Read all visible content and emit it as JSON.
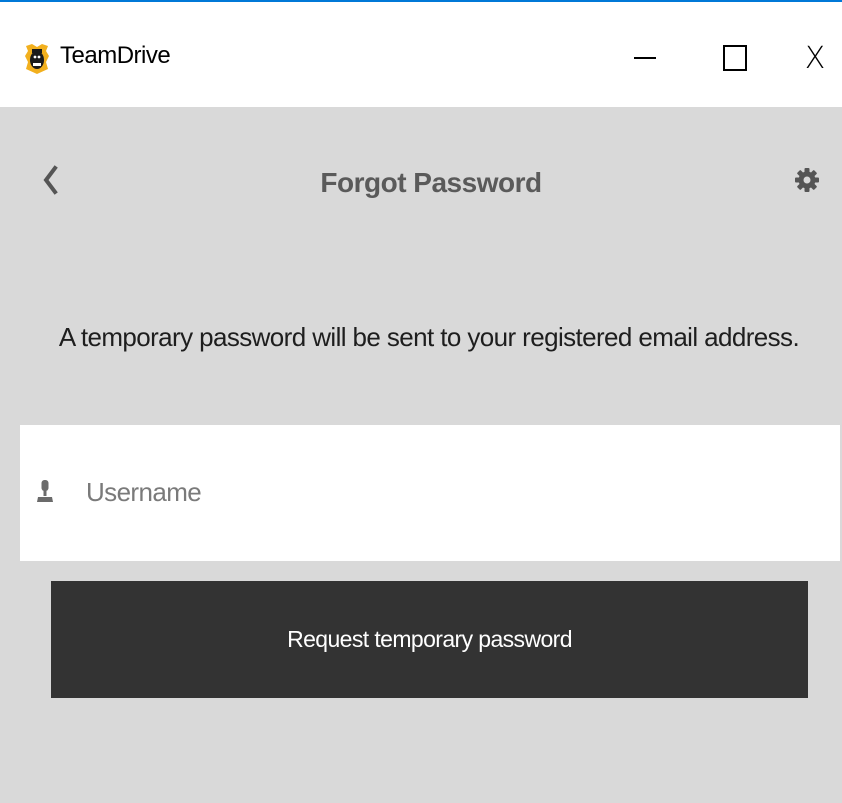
{
  "window": {
    "title": "TeamDrive",
    "minimize_icon": "minimize-icon",
    "maximize_icon": "maximize-icon",
    "close_glyph": "X"
  },
  "header": {
    "title": "Forgot Password",
    "back_icon": "chevron-left-icon",
    "settings_icon": "gear-icon"
  },
  "main": {
    "info_text": "A temporary password will be sent to your registered email address.",
    "username": {
      "value": "",
      "placeholder": "Username",
      "icon": "user-icon"
    },
    "request_button_label": "Request temporary password"
  },
  "colors": {
    "background": "#d9d9d9",
    "titlebar": "#ffffff",
    "button": "#333333",
    "title_text": "#5a5a5a",
    "logo_accent": "#f2b01e"
  }
}
